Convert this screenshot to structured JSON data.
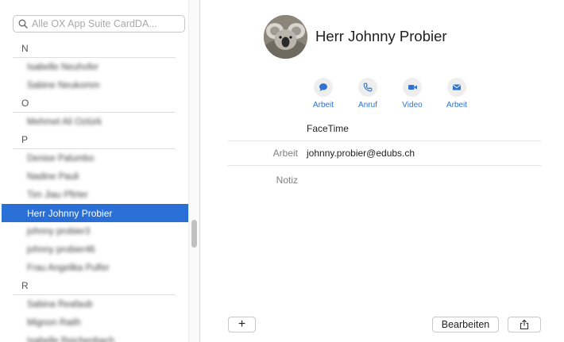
{
  "search": {
    "placeholder": "Alle OX App Suite CardDA..."
  },
  "contacts": [
    {
      "letter": "N",
      "rows": [
        {
          "name": "Isabelle Neuhofer",
          "blurred": true
        },
        {
          "name": "Sabine Neukomm",
          "blurred": true
        }
      ]
    },
    {
      "letter": "O",
      "rows": [
        {
          "name": "Mehmet Ali Öztürk",
          "blurred": true
        }
      ]
    },
    {
      "letter": "P",
      "rows": [
        {
          "name": "Denise Palumbo",
          "blurred": true
        },
        {
          "name": "Nadine Pauli",
          "blurred": true
        },
        {
          "name": "Tim Jiau Pfirter",
          "blurred": true
        },
        {
          "name": "Herr Johnny Probier",
          "blurred": false,
          "selected": true
        },
        {
          "name": "johnny probier3",
          "blurred": true
        },
        {
          "name": "johnny probier46",
          "blurred": true
        },
        {
          "name": "Frau Angelika Pulfer",
          "blurred": true
        }
      ]
    },
    {
      "letter": "R",
      "rows": [
        {
          "name": "Sabina Reafaub",
          "blurred": true
        },
        {
          "name": "Mignon Raith",
          "blurred": true
        },
        {
          "name": "Isabelle Reichenbach",
          "blurred": true
        }
      ]
    }
  ],
  "detail": {
    "name": "Herr Johnny Probier",
    "actions": [
      {
        "label": "Arbeit",
        "icon": "message-bubble-icon"
      },
      {
        "label": "Anruf",
        "icon": "phone-icon"
      },
      {
        "label": "Video",
        "icon": "video-camera-icon"
      },
      {
        "label": "Arbeit",
        "icon": "mail-envelope-icon"
      }
    ],
    "facetime": "FaceTime",
    "email_label": "Arbeit",
    "email_value": "johnny.probier@edubs.ch",
    "note_label": "Notiz"
  },
  "toolbar": {
    "add_label": "+",
    "edit_label": "Bearbeiten",
    "share_icon": "share-icon"
  },
  "colors": {
    "accent": "#2a6fd6",
    "link": "#2f72d0"
  }
}
